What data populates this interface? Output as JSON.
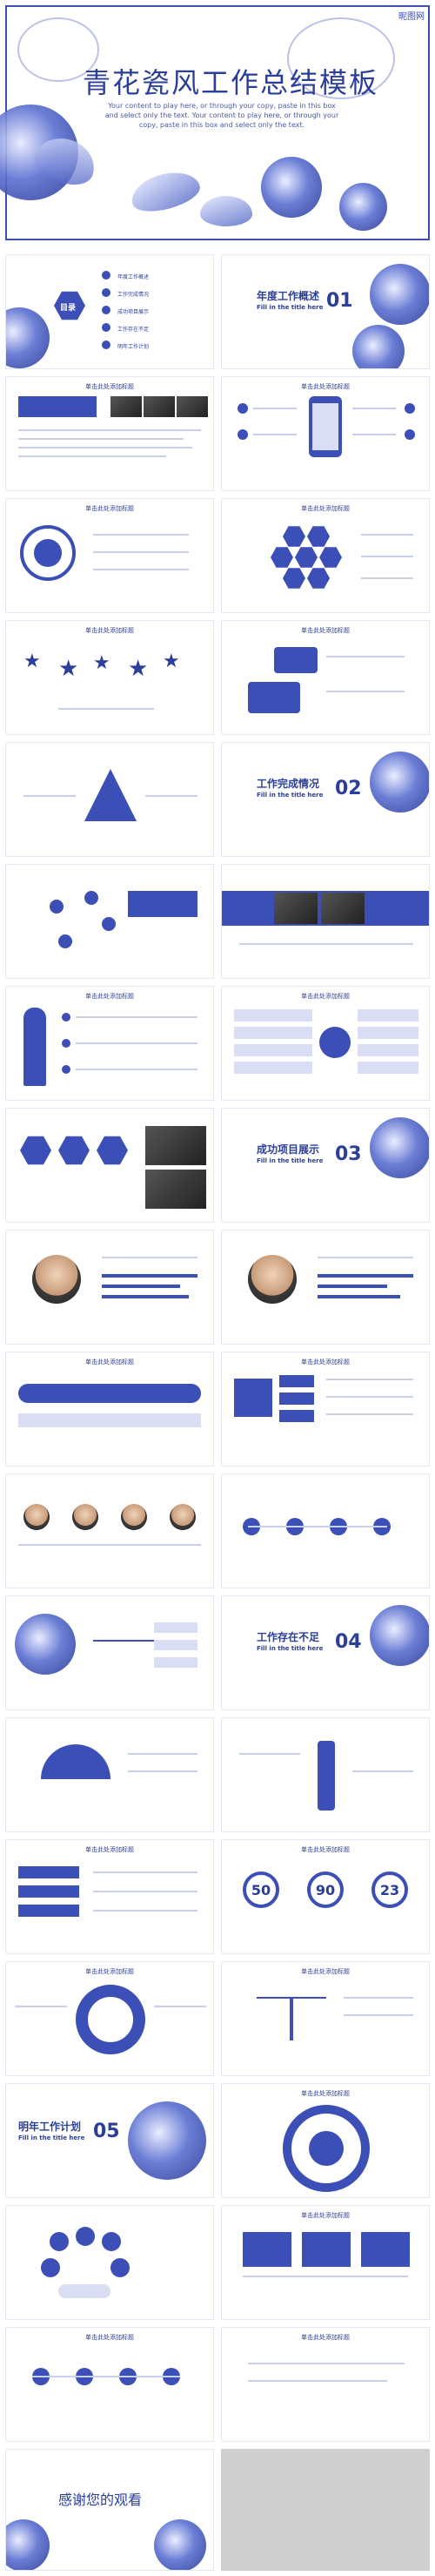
{
  "cover": {
    "logo": "昵图网",
    "title": "青花瓷风工作总结模板",
    "subtitle": "Your content to play here, or through your copy, paste in this box and select only the text. Your content to play here, or through your copy, paste in this box and select only the text."
  },
  "toc": {
    "label": "目录",
    "items": [
      "年度工作概述",
      "工作完成情况",
      "成功项目展示",
      "工作存在不足",
      "明年工作计划"
    ]
  },
  "section_titles": [
    {
      "cn": "年度工作概述",
      "en": "Fill in the title here",
      "num": "01"
    },
    {
      "cn": "工作完成情况",
      "en": "Fill in the title here",
      "num": "02"
    },
    {
      "cn": "成功项目展示",
      "en": "Fill in the title here",
      "num": "03"
    },
    {
      "cn": "工作存在不足",
      "en": "Fill in the title here",
      "num": "04"
    },
    {
      "cn": "明年工作计划",
      "en": "Fill in the title here",
      "num": "05"
    }
  ],
  "slide_header": "单击此处添加标题",
  "stats": {
    "a": "50",
    "b": "90",
    "c": "23"
  },
  "thanks": "感谢您的观看",
  "colors": {
    "primary": "#3b4fb6",
    "dark": "#2b3f9a",
    "light": "#d9def5"
  }
}
